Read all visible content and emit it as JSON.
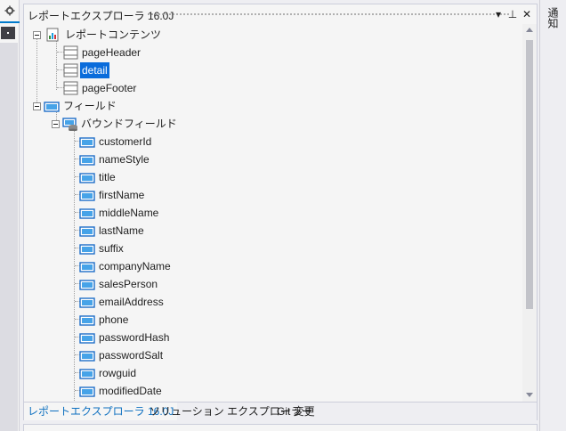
{
  "panel": {
    "title": "レポートエクスプローラ 16.0J",
    "buttons": {
      "dropdown": "▾",
      "pin": "⊥",
      "close": "✕"
    }
  },
  "tree": {
    "root_content": {
      "label": "レポートコンテンツ",
      "icon": "report-icon"
    },
    "sections": [
      {
        "label": "pageHeader",
        "icon": "section-icon",
        "selected": false
      },
      {
        "label": "detail",
        "icon": "section-icon",
        "selected": true
      },
      {
        "label": "pageFooter",
        "icon": "section-icon",
        "selected": false
      }
    ],
    "fields_root": {
      "label": "フィールド",
      "icon": "field-icon"
    },
    "bound_fields": {
      "label": "バウンドフィールド",
      "icon": "database-icon"
    },
    "fields": [
      "customerId",
      "nameStyle",
      "title",
      "firstName",
      "middleName",
      "lastName",
      "suffix",
      "companyName",
      "salesPerson",
      "emailAddress",
      "phone",
      "passwordHash",
      "passwordSalt",
      "rowguid",
      "modifiedDate"
    ]
  },
  "tabs": [
    {
      "label": "レポートエクスプローラ 16.0J",
      "active": true
    },
    {
      "label": "ソリューション エクスプローラー",
      "active": false
    },
    {
      "label": "Git 変更",
      "active": false
    }
  ],
  "right_sidebar": {
    "label": "通知"
  },
  "colors": {
    "selection": "#0a6cdb",
    "accent": "#007acc",
    "active_tab_text": "#0e70c0"
  }
}
